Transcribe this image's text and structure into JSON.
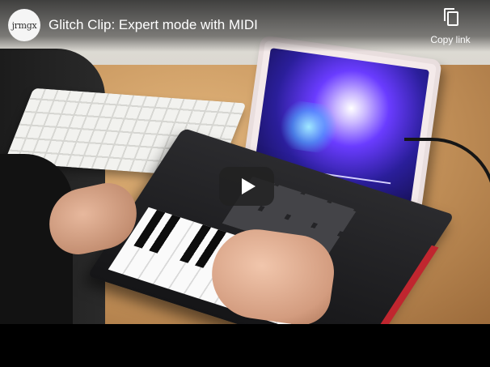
{
  "channel": {
    "avatar_text": "jrmgx"
  },
  "video": {
    "title": "Glitch Clip: Expert mode with MIDI"
  },
  "actions": {
    "copy_link_label": "Copy link",
    "copy_link_icon": "copy-icon"
  },
  "player": {
    "play_icon": "play-icon",
    "play_button_color": "#212121"
  }
}
